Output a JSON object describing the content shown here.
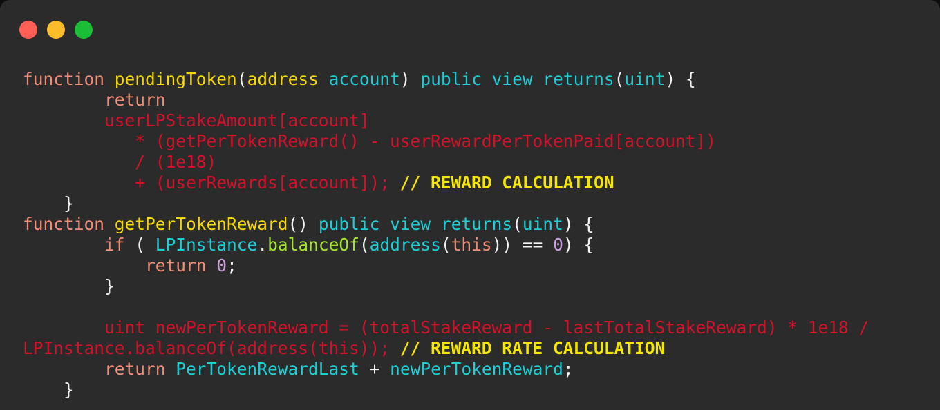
{
  "window": {
    "background": "#2b2b2b",
    "page_background": "#0d0d0d",
    "traffic_lights": [
      {
        "name": "close",
        "color": "#ff5f56"
      },
      {
        "name": "minimize",
        "color": "#fdbc2c"
      },
      {
        "name": "maximize",
        "color": "#1bbf37"
      }
    ]
  },
  "theme": {
    "keyword": "#f08d77",
    "function_name": "#f5d800",
    "type": "#1ccfd6",
    "method": "#a6e22e",
    "number": "#c9a0dc",
    "punctuation": "#f2f2f2",
    "highlight": "#d2112b",
    "comment": "#f5e600",
    "foreground": "#e8e8e8"
  },
  "code": {
    "language": "solidity",
    "lines": [
      {
        "n": 1,
        "text": "function pendingToken(address account) public view returns(uint) {",
        "tokens": [
          {
            "t": "function",
            "c": "kw"
          },
          {
            "t": " ",
            "c": "punc"
          },
          {
            "t": "pendingToken",
            "c": "fn"
          },
          {
            "t": "(",
            "c": "punc"
          },
          {
            "t": "address",
            "c": "fn"
          },
          {
            "t": " ",
            "c": "punc"
          },
          {
            "t": "account",
            "c": "type"
          },
          {
            "t": ")",
            "c": "punc"
          },
          {
            "t": " ",
            "c": "punc"
          },
          {
            "t": "public view returns",
            "c": "type"
          },
          {
            "t": "(",
            "c": "punc"
          },
          {
            "t": "uint",
            "c": "type"
          },
          {
            "t": ") {",
            "c": "punc"
          }
        ]
      },
      {
        "n": 2,
        "text": "        return",
        "tokens": [
          {
            "t": "        ",
            "c": "punc"
          },
          {
            "t": "return",
            "c": "kw"
          }
        ]
      },
      {
        "n": 3,
        "text": "        userLPStakeAmount[account]",
        "tokens": [
          {
            "t": "        ",
            "c": "punc"
          },
          {
            "t": "userLPStakeAmount[account]",
            "c": "hl"
          }
        ]
      },
      {
        "n": 4,
        "text": "           * (getPerTokenReward() - userRewardPerTokenPaid[account])",
        "tokens": [
          {
            "t": "           ",
            "c": "punc"
          },
          {
            "t": "* (getPerTokenReward() - userRewardPerTokenPaid[account])",
            "c": "hl"
          }
        ]
      },
      {
        "n": 5,
        "text": "           / (1e18)",
        "tokens": [
          {
            "t": "           ",
            "c": "punc"
          },
          {
            "t": "/ (1e18)",
            "c": "hl"
          }
        ]
      },
      {
        "n": 6,
        "text": "           + (userRewards[account]); // REWARD CALCULATION",
        "tokens": [
          {
            "t": "           ",
            "c": "punc"
          },
          {
            "t": "+ (userRewards[account]); ",
            "c": "hl"
          },
          {
            "t": "// REWARD CALCULATION",
            "c": "cmt"
          }
        ]
      },
      {
        "n": 7,
        "text": "    }",
        "tokens": [
          {
            "t": "    ",
            "c": "punc"
          },
          {
            "t": "}",
            "c": "punc"
          }
        ]
      },
      {
        "n": 8,
        "text": "function getPerTokenReward() public view returns(uint) {",
        "tokens": [
          {
            "t": "function",
            "c": "kw"
          },
          {
            "t": " ",
            "c": "punc"
          },
          {
            "t": "getPerTokenReward",
            "c": "fn"
          },
          {
            "t": "() ",
            "c": "punc"
          },
          {
            "t": "public view returns",
            "c": "type"
          },
          {
            "t": "(",
            "c": "punc"
          },
          {
            "t": "uint",
            "c": "type"
          },
          {
            "t": ") {",
            "c": "punc"
          }
        ]
      },
      {
        "n": 9,
        "text": "        if ( LPInstance.balanceOf(address(this)) == 0) {",
        "tokens": [
          {
            "t": "        ",
            "c": "punc"
          },
          {
            "t": "if",
            "c": "kw"
          },
          {
            "t": " ( ",
            "c": "punc"
          },
          {
            "t": "LPInstance",
            "c": "type"
          },
          {
            "t": ".",
            "c": "punc"
          },
          {
            "t": "balanceOf",
            "c": "meth"
          },
          {
            "t": "(",
            "c": "punc"
          },
          {
            "t": "address",
            "c": "type"
          },
          {
            "t": "(",
            "c": "punc"
          },
          {
            "t": "this",
            "c": "kw"
          },
          {
            "t": ")) == ",
            "c": "punc"
          },
          {
            "t": "0",
            "c": "num"
          },
          {
            "t": ") {",
            "c": "punc"
          }
        ]
      },
      {
        "n": 10,
        "text": "            return 0;",
        "tokens": [
          {
            "t": "            ",
            "c": "punc"
          },
          {
            "t": "return",
            "c": "kw"
          },
          {
            "t": " ",
            "c": "punc"
          },
          {
            "t": "0",
            "c": "num"
          },
          {
            "t": ";",
            "c": "punc"
          }
        ]
      },
      {
        "n": 11,
        "text": "        }",
        "tokens": [
          {
            "t": "        ",
            "c": "punc"
          },
          {
            "t": "}",
            "c": "punc"
          }
        ]
      },
      {
        "n": 12,
        "text": "",
        "tokens": []
      },
      {
        "n": 13,
        "text": "        uint newPerTokenReward = (totalStakeReward - lastTotalStakeReward) * 1e18 /",
        "tokens": [
          {
            "t": "        ",
            "c": "punc"
          },
          {
            "t": "uint newPerTokenReward = (totalStakeReward - lastTotalStakeReward) * 1e18 /",
            "c": "hl"
          }
        ]
      },
      {
        "n": 14,
        "text": "LPInstance.balanceOf(address(this)); // REWARD RATE CALCULATION",
        "wrapped": true,
        "tokens": [
          {
            "t": "LPInstance.balanceOf(address(this)); ",
            "c": "hl"
          },
          {
            "t": "// REWARD RATE CALCULATION",
            "c": "cmt"
          }
        ]
      },
      {
        "n": 15,
        "text": "        return PerTokenRewardLast + newPerTokenReward;",
        "tokens": [
          {
            "t": "        ",
            "c": "punc"
          },
          {
            "t": "return",
            "c": "kw"
          },
          {
            "t": " ",
            "c": "punc"
          },
          {
            "t": "PerTokenRewardLast",
            "c": "type"
          },
          {
            "t": " + ",
            "c": "punc"
          },
          {
            "t": "newPerTokenReward",
            "c": "type"
          },
          {
            "t": ";",
            "c": "punc"
          }
        ]
      },
      {
        "n": 16,
        "text": "    }",
        "tokens": [
          {
            "t": "    ",
            "c": "punc"
          },
          {
            "t": "}",
            "c": "punc"
          }
        ]
      }
    ]
  }
}
